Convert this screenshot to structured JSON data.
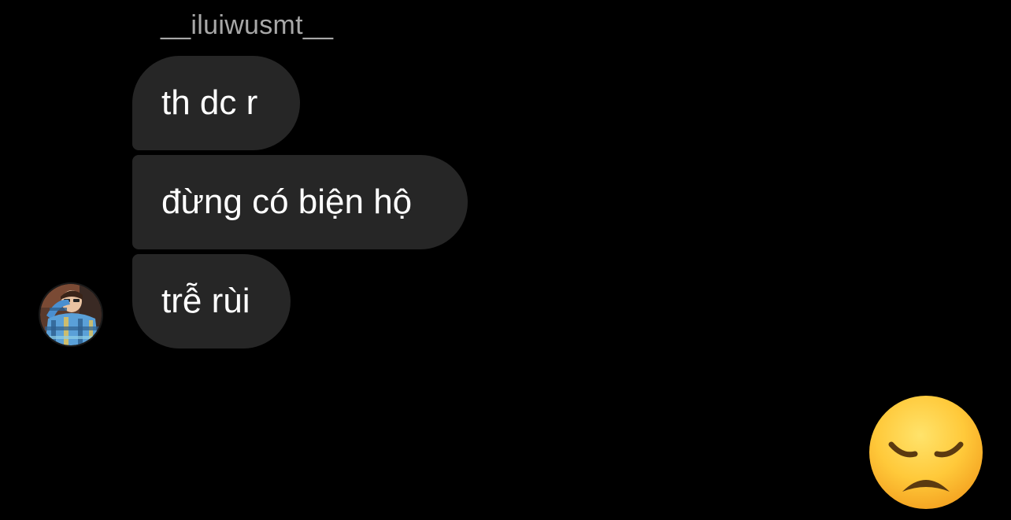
{
  "conversation": {
    "sender": {
      "username": "__iluiwusmt__",
      "avatar": "profile-photo-avatar"
    },
    "messages": [
      {
        "text": "th dc r"
      },
      {
        "text": "đừng có biện hộ"
      },
      {
        "text": "trễ rùi"
      }
    ]
  },
  "reaction": {
    "icon": "disappointed-face-emoji"
  },
  "colors": {
    "background": "#000000",
    "bubble": "#262626",
    "message_text": "#ffffff",
    "username_text": "#a8a8a8"
  }
}
